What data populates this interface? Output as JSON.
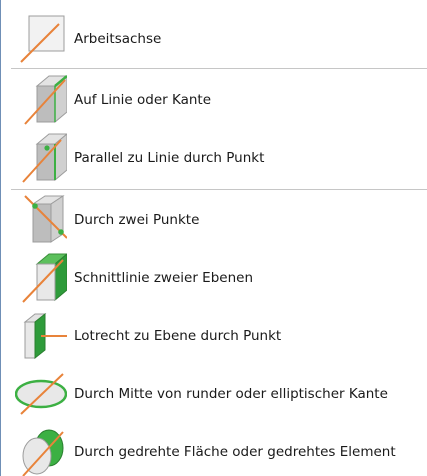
{
  "menu": {
    "items": [
      {
        "label": "Arbeitsachse",
        "icon": "work-axis-icon"
      },
      {
        "label": "Auf Linie oder Kante",
        "icon": "axis-on-edge-icon"
      },
      {
        "label": "Parallel zu Linie durch Punkt",
        "icon": "axis-parallel-through-point-icon"
      },
      {
        "label": "Durch zwei Punkte",
        "icon": "axis-two-points-icon"
      },
      {
        "label": "Schnittlinie zweier Ebenen",
        "icon": "axis-plane-intersection-icon"
      },
      {
        "label": "Lotrecht zu Ebene durch Punkt",
        "icon": "axis-normal-to-plane-icon"
      },
      {
        "label": "Durch Mitte von runder oder elliptischer Kante",
        "icon": "axis-through-circular-edge-icon"
      },
      {
        "label": "Durch gedrehte Fläche oder gedrehtes Element",
        "icon": "axis-through-revolved-face-icon"
      }
    ]
  },
  "colors": {
    "axis_orange": "#e8833a",
    "highlight_green": "#3cb043",
    "box_gray": "#c8c8c8",
    "border_blue": "#6f8fb6",
    "separator": "#c6c6c6"
  }
}
